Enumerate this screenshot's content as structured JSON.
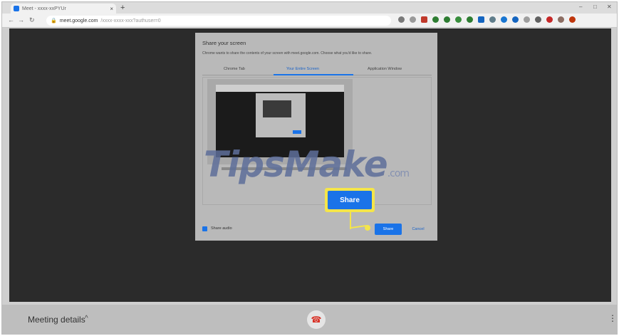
{
  "browser": {
    "tab_title": "Meet - xxxx-xxPYUr",
    "tab_close": "×",
    "new_tab": "+",
    "window_min": "–",
    "window_max": "□",
    "window_close": "✕",
    "url_host": "meet.google.com",
    "url_path": "/xxxx-xxxx-xxx?authuser=0"
  },
  "dialog": {
    "title": "Share your screen",
    "description": "Chrome wants to share the contents of your screen with meet.google.com. Choose what you'd like to share.",
    "tabs": [
      "Chrome Tab",
      "Your Entire Screen",
      "Application Window"
    ],
    "active_tab": "Your Entire Screen",
    "share_audio_label": "Share audio",
    "share_button": "Share",
    "cancel_button": "Cancel"
  },
  "callout": {
    "label": "Share",
    "color": "#f4e54a"
  },
  "watermark": {
    "text": "TipsMake",
    "suffix": ".com"
  },
  "meet": {
    "meeting_details": "Meeting details",
    "chevron": "^",
    "hangup_icon": "phone-hangup-icon",
    "more_icon": "⋮"
  },
  "colors": {
    "accent": "#1a73e8",
    "hangup": "#d93025",
    "stage": "#2b2b2b"
  }
}
